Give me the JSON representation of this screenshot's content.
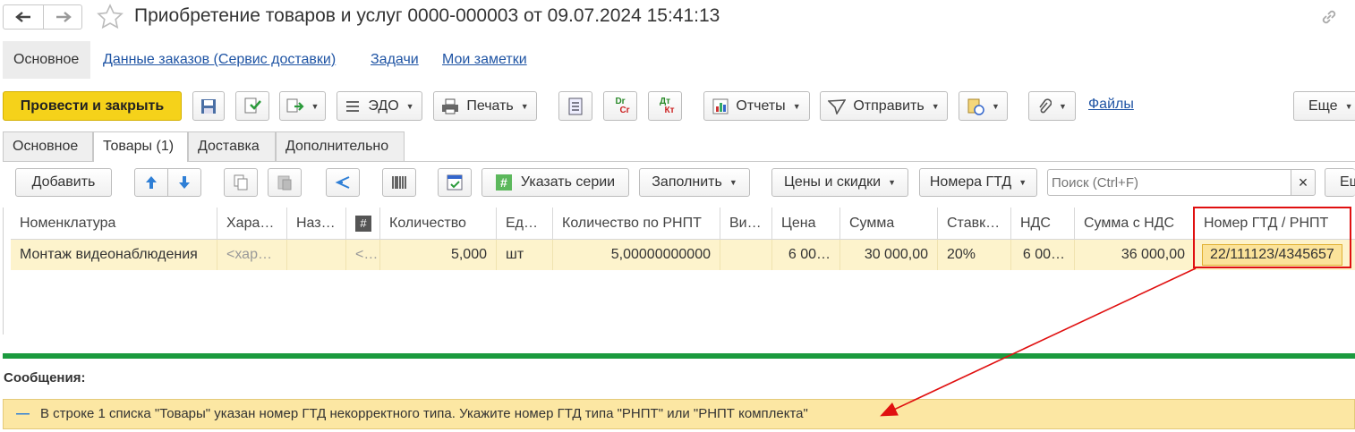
{
  "window": {
    "title": "Приобретение товаров и услуг 0000-000003 от 09.07.2024 15:41:13",
    "back_icon": "arrow-left-icon",
    "forward_icon": "arrow-right-icon",
    "favorite_icon": "star-icon",
    "link_icon": "chain-link-icon"
  },
  "form_tabs": {
    "main": "Основное",
    "orders": "Данные заказов (Сервис доставки)",
    "tasks": "Задачи",
    "notes": "Мои заметки"
  },
  "toolbar": {
    "post_close": "Провести и закрыть",
    "edo": "ЭДО",
    "print": "Печать",
    "dr_top": "Dr",
    "dr_bottom": "Cr",
    "dt_top": "Дт",
    "dt_bottom": "Кт",
    "reports": "Отчеты",
    "send": "Отправить",
    "files": "Файлы",
    "more": "Еще",
    "help": "?"
  },
  "tabs": [
    "Основное",
    "Товары (1)",
    "Доставка",
    "Дополнительно"
  ],
  "table_toolbar": {
    "add": "Добавить",
    "series": "Указать серии",
    "series_icon_text": "#",
    "fill": "Заполнить",
    "prices": "Цены и скидки",
    "gtd": "Номера ГТД",
    "search_placeholder": "Поиск (Ctrl+F)",
    "clear": "×",
    "more": "Ещ"
  },
  "table": {
    "columns": [
      "Номенклатура",
      "Хара…",
      "Наз…",
      "#",
      "Количество",
      "Ед…",
      "Количество по РНПТ",
      "Ви…",
      "Цена",
      "Сумма",
      "Ставк…",
      "НДС",
      "Сумма с НДС",
      "Номер ГТД / РНПТ"
    ],
    "row": [
      "Монтаж видеонаблюдения",
      "<хар…",
      "",
      "<…",
      "5,000",
      "шт",
      "5,00000000000",
      "",
      "6 00…",
      "30 000,00",
      "20%",
      "6 00…",
      "36 000,00",
      "22/111123/4345657"
    ]
  },
  "messages": {
    "title": "Сообщения:",
    "text": "В строке 1 списка \"Товары\" указан номер ГТД некорректного типа. Укажите номер ГТД типа \"РНПТ\" или \"РНПТ комплекта\""
  },
  "colors": {
    "primary_button": "#f5d21a",
    "row_highlight": "#fdf3cc",
    "annotation_red": "#e01010",
    "separator_green": "#1b9a3e",
    "link": "#1f54a4"
  }
}
